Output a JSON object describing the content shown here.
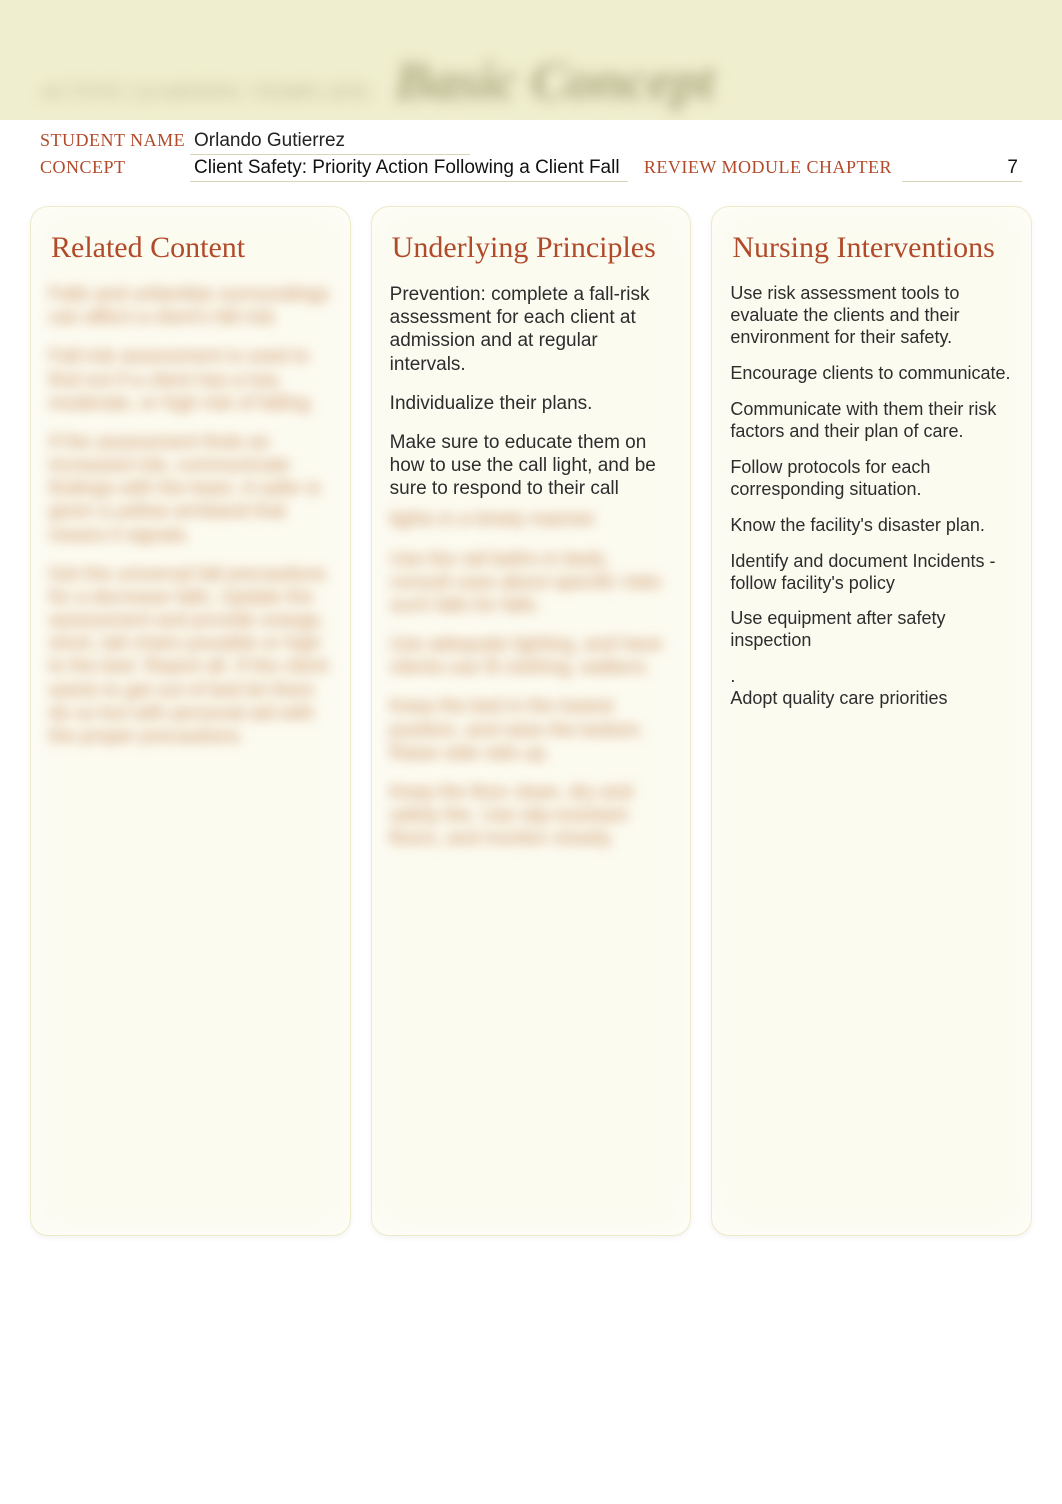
{
  "header": {
    "subtitle": "ACTIVE LEARNING TEMPLATE:",
    "title": "Basic Concept"
  },
  "meta": {
    "student_name_label": "STUDENT NAME",
    "student_name": "Orlando Gutierrez",
    "concept_label": "CONCEPT",
    "concept": "Client Safety: Priority Action Following a Client Fall",
    "rmc_label": "REVIEW MODULE CHAPTER",
    "rmc_value": "7"
  },
  "columns": {
    "related": {
      "title": "Related Content",
      "blurred_paragraphs": [
        "Falls and unfamiliar surroundings can affect a client's fall risk.",
        "Fall-risk assessment is used to find out if a client has a low, moderate, or high risk of falling.",
        "If the assessment finds an increased risk, communicate findings with the team. A safer is given a yellow armband that means it signals.",
        "Get the universal fall precautions for a decrease falls. Update the assessment and provide orange, short, tall chairs possible or high to the bed. Report all. If the client wants to get out of bed let them do so but with personal aid with the proper precautions."
      ]
    },
    "principles": {
      "title": "Underlying Principles",
      "visible_paragraphs": [
        "Prevention: complete a fall-risk assessment for each client at admission and at regular intervals.",
        "Individualize their plans.",
        "Make sure to educate them on how to use the call light, and be sure to respond to their call"
      ],
      "blurred_paragraphs": [
        "lights in a timely manner.",
        "Use the rail baths in beds, consult case about specific risks such falls for falls.",
        "Use adequate lighting, and have clients use fit clothing, walkers.",
        "Keep the bed in the lowest position, and raise the bottom. Raise side rails up.",
        "Keep the floor clean, dry and safely the. Use slip-resistant floors, and monitor closely."
      ]
    },
    "nursing": {
      "title": "Nursing Interventions",
      "paragraphs": [
        "Use risk assessment tools to evaluate the clients and their environment for their safety.",
        "Encourage clients to communicate.",
        "Communicate with them their risk factors and their plan of care.",
        "Follow protocols for each corresponding situation.",
        "Know the facility's disaster plan.",
        "Identify and document Incidents - follow facility's policy",
        "Use equipment after safety inspection",
        ".",
        "Adopt quality care priorities"
      ]
    }
  }
}
